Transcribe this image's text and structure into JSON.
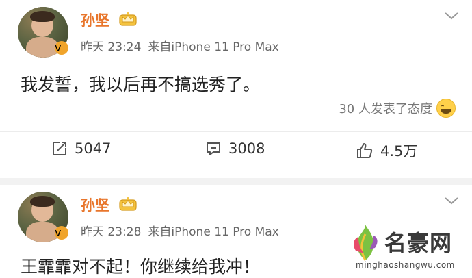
{
  "posts": [
    {
      "author": "孙坚",
      "badge": "v",
      "time": "昨天 23:24",
      "source": "来自iPhone 11 Pro Max",
      "text": "我发誓，我以后再不搞选秀了。",
      "reactions_text": "30 人发表了态度",
      "actions": {
        "reposts": "5047",
        "comments": "3008",
        "likes": "4.5万"
      }
    },
    {
      "author": "孙坚",
      "badge": "v",
      "time": "昨天 23:28",
      "source": "来自iPhone 11 Pro Max",
      "text": "王霏霏对不起！你继续给我冲！"
    }
  ],
  "watermark": {
    "title": "名豪网",
    "url": "minghaoshangwu.com"
  },
  "colors": {
    "name": "#e8762c",
    "vbadge": "#f0a42b",
    "text": "#222222",
    "meta": "#666666"
  }
}
